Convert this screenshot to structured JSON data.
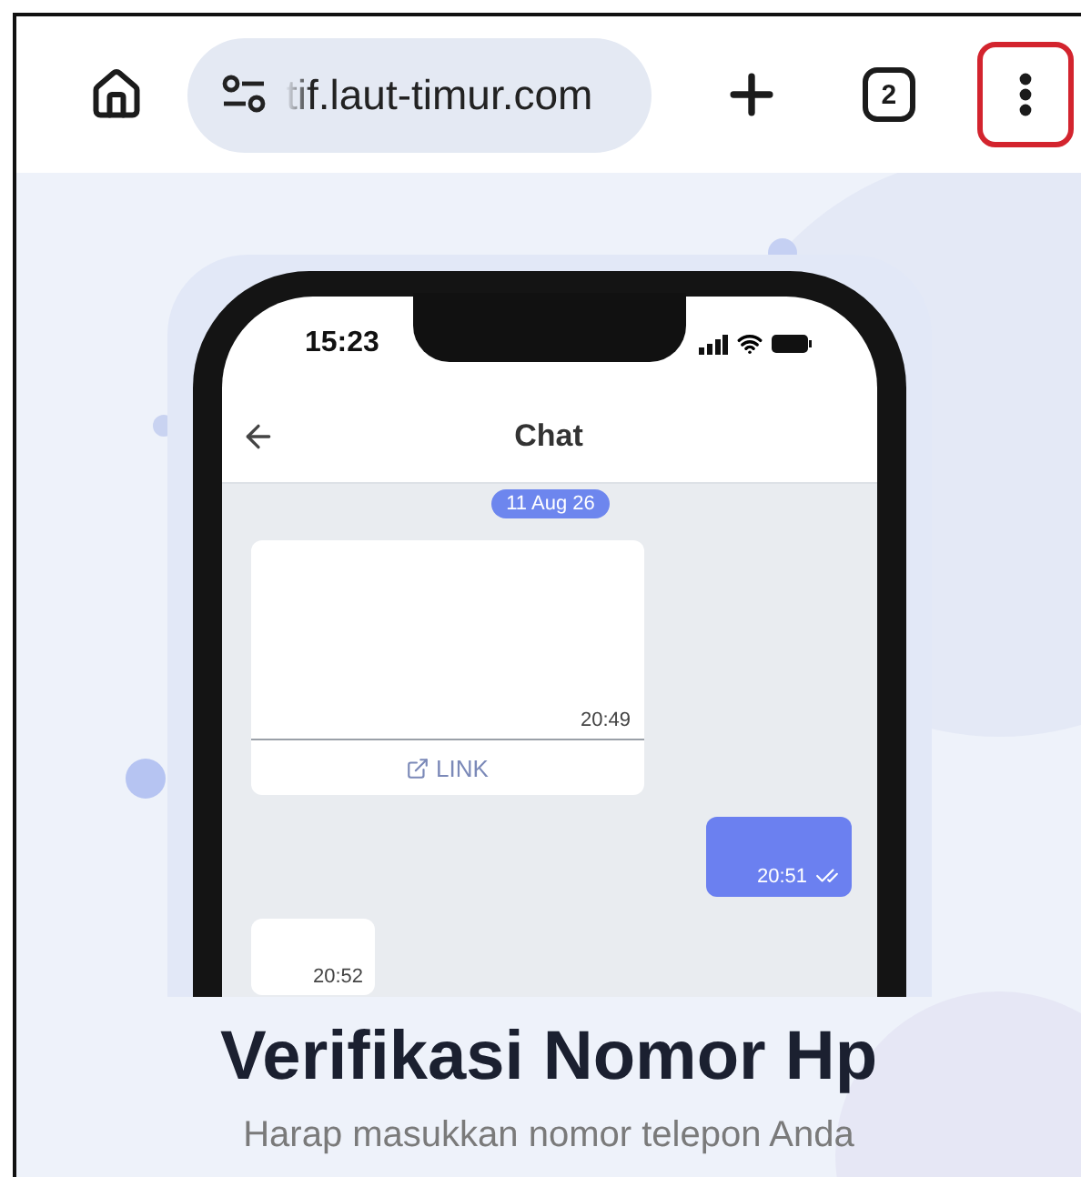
{
  "browser": {
    "url": "tif.laut-timur.com",
    "tab_count": "2",
    "menu_highlighted": true
  },
  "phone": {
    "time": "15:23",
    "chat_title": "Chat",
    "date_chip": "11 Aug 26",
    "messages": [
      {
        "kind": "incoming-card",
        "time": "20:49",
        "link_label": "LINK"
      },
      {
        "kind": "outgoing",
        "time": "20:51",
        "read": true
      },
      {
        "kind": "incoming",
        "time": "20:52"
      }
    ]
  },
  "heading": "Verifikasi Nomor Hp",
  "subtitle": "Harap masukkan nomor telepon Anda"
}
